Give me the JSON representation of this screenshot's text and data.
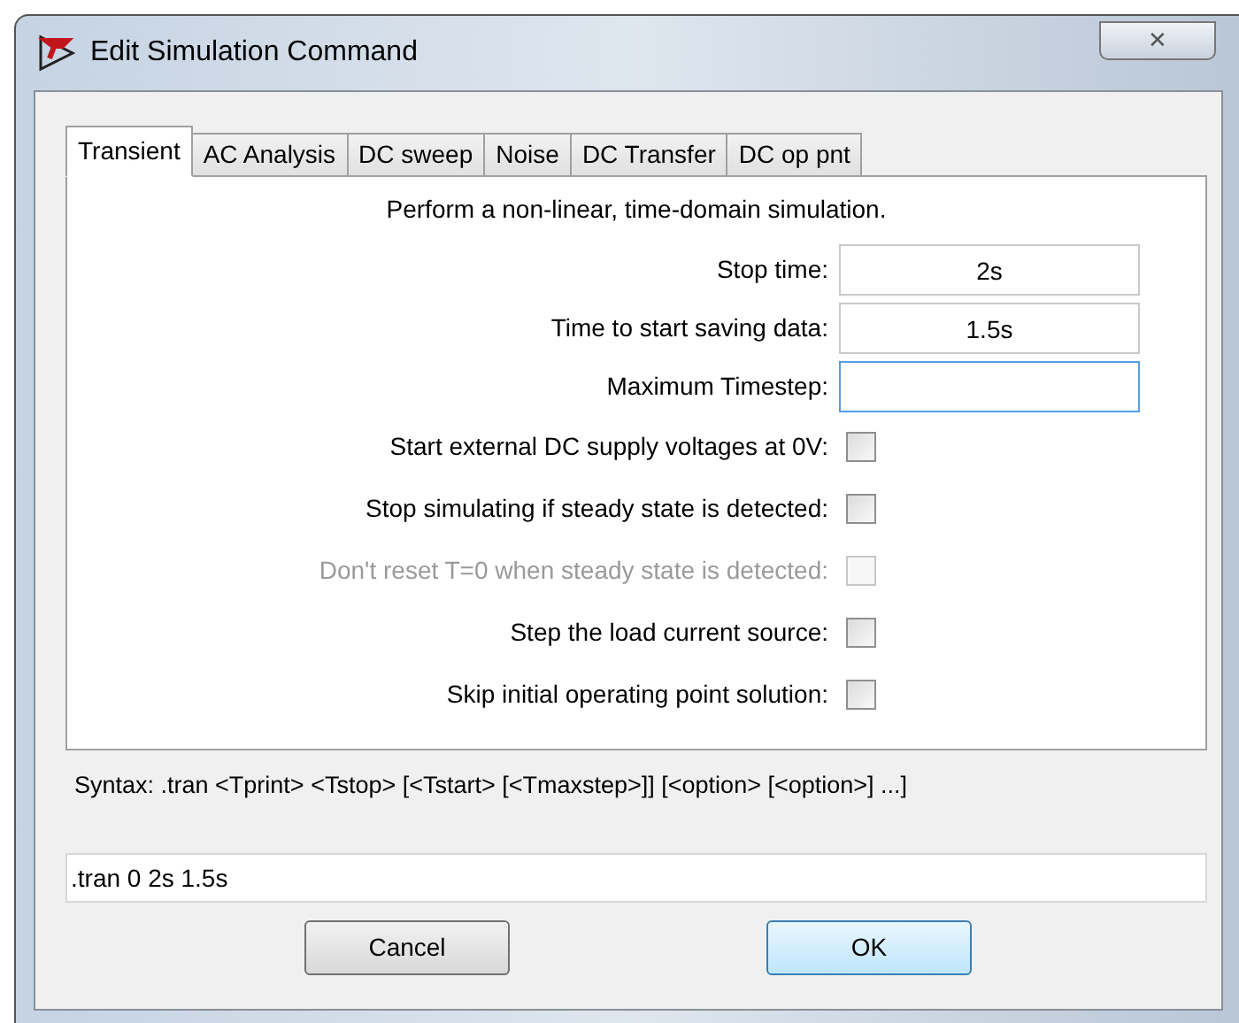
{
  "window": {
    "title": "Edit Simulation Command",
    "close": "✕"
  },
  "tabs": [
    {
      "label": "Transient",
      "selected": true
    },
    {
      "label": "AC Analysis",
      "selected": false
    },
    {
      "label": "DC sweep",
      "selected": false
    },
    {
      "label": "Noise",
      "selected": false
    },
    {
      "label": "DC Transfer",
      "selected": false
    },
    {
      "label": "DC op pnt",
      "selected": false
    }
  ],
  "description": "Perform a non-linear, time-domain simulation.",
  "fields": [
    {
      "kind": "text",
      "label": "Stop time:",
      "value": "2s",
      "focused": false
    },
    {
      "kind": "text",
      "label": "Time to start saving data:",
      "value": "1.5s",
      "focused": false
    },
    {
      "kind": "text",
      "label": "Maximum Timestep:",
      "focused": true
    },
    {
      "kind": "checkbox",
      "label": "Start external DC supply voltages at 0V:",
      "checked": false,
      "disabled": false
    },
    {
      "kind": "checkbox",
      "label": "Stop simulating if steady state is detected:",
      "checked": false,
      "disabled": false
    },
    {
      "kind": "checkbox",
      "label": "Don't reset T=0 when steady state is detected:",
      "checked": false,
      "disabled": true
    },
    {
      "kind": "checkbox",
      "label": "Step the load current source:",
      "checked": false,
      "disabled": false
    },
    {
      "kind": "checkbox",
      "label": "Skip initial operating point solution:",
      "checked": false,
      "disabled": false
    }
  ],
  "syntax": "Syntax:  .tran <Tprint> <Tstop> [<Tstart> [<Tmaxstep>]] [<option> [<option>] ...]",
  "command": ".tran 0 2s 1.5s",
  "buttons": [
    {
      "label": "Cancel",
      "default": false
    },
    {
      "label": "OK",
      "default": true
    }
  ]
}
